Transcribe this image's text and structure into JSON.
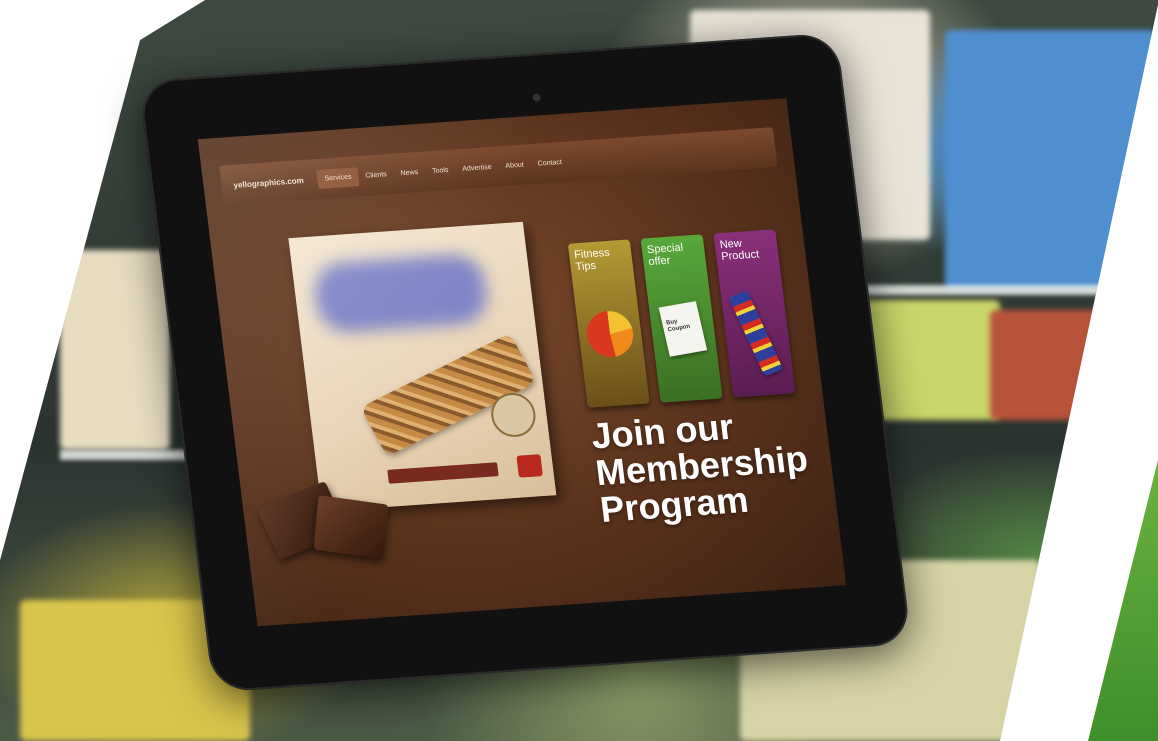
{
  "screen": {
    "nav": {
      "brand": "yellographics.com",
      "items": [
        "Services",
        "Clients",
        "News",
        "Tools",
        "Advertise",
        "About",
        "Contact"
      ],
      "active_index": 0
    },
    "tiles": [
      {
        "title": "Fitness Tips",
        "icon": "pie-chart-icon",
        "color": "#b59a34"
      },
      {
        "title": "Special offer",
        "icon": "coupon-icon",
        "coupon_text": "Buy Coupon",
        "color": "#58a83a"
      },
      {
        "title": "New Product",
        "icon": "candy-bar-icon",
        "color": "#8a2f7a"
      }
    ],
    "cta": {
      "line1": "Join our",
      "line2": "Membership",
      "line3": "Program"
    }
  }
}
